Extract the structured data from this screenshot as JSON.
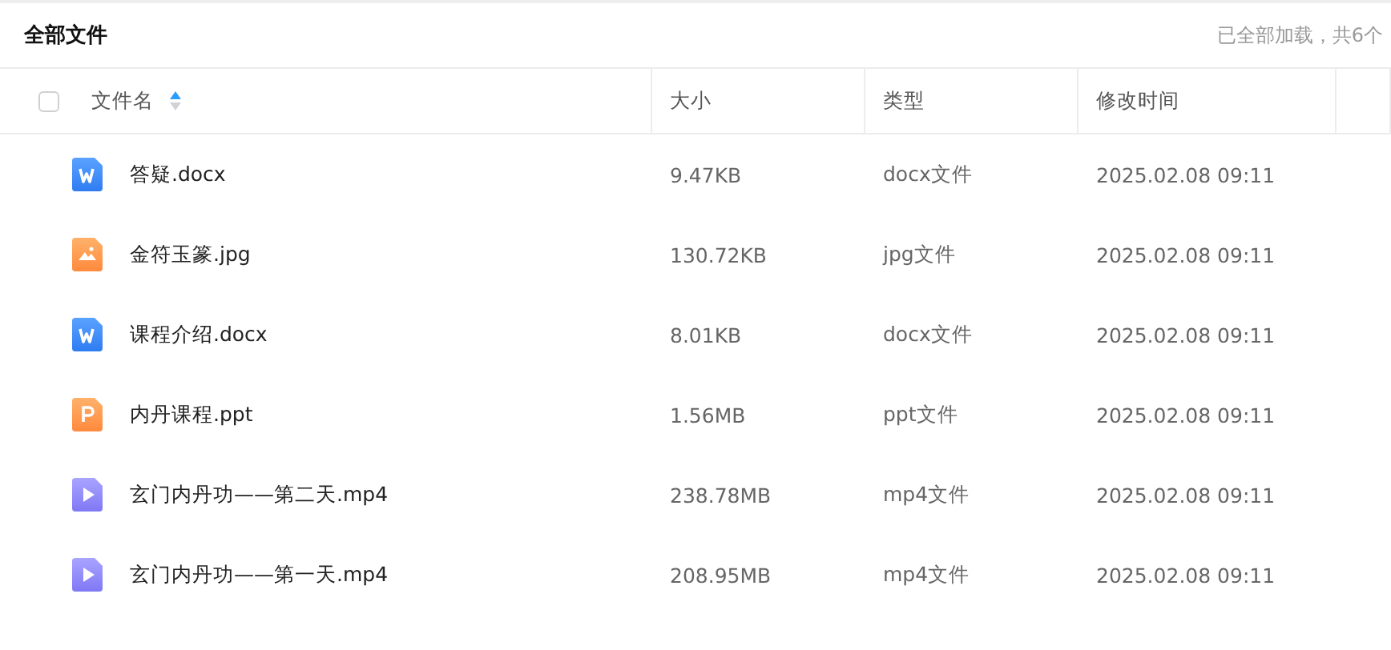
{
  "title": "全部文件",
  "load_status": "已全部加载，共6个",
  "table": {
    "select_all": {
      "checked": false
    },
    "columns": [
      {
        "label": "文件名",
        "sortable": true
      },
      {
        "label": "大小",
        "sortable": false
      },
      {
        "label": "类型",
        "sortable": false
      },
      {
        "label": "修改时间",
        "sortable": false
      }
    ],
    "rows": [
      {
        "kind": "word",
        "name": "答疑.docx",
        "size": "9.47KB",
        "type": "docx文件",
        "modified": "2025.02.08 09:11"
      },
      {
        "kind": "image",
        "name": "金符玉篆.jpg",
        "size": "130.72KB",
        "type": "jpg文件",
        "modified": "2025.02.08 09:11"
      },
      {
        "kind": "word",
        "name": "课程介绍.docx",
        "size": "8.01KB",
        "type": "docx文件",
        "modified": "2025.02.08 09:11"
      },
      {
        "kind": "ppt",
        "name": "内丹课程.ppt",
        "size": "1.56MB",
        "type": "ppt文件",
        "modified": "2025.02.08 09:11"
      },
      {
        "kind": "video",
        "name": "玄门内丹功——第二天.mp4",
        "size": "238.78MB",
        "type": "mp4文件",
        "modified": "2025.02.08 09:11"
      },
      {
        "kind": "video",
        "name": "玄门内丹功——第一天.mp4",
        "size": "208.95MB",
        "type": "mp4文件",
        "modified": "2025.02.08 09:11"
      }
    ]
  }
}
